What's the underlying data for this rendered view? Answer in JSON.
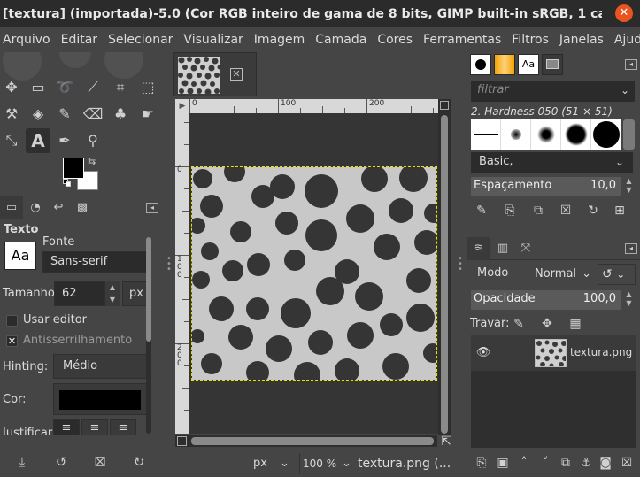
{
  "window": {
    "title": "[textura] (importada)-5.0 (Cor RGB inteiro de gama de 8 bits, GIMP built-in sRGB, 1 ca..."
  },
  "menu": [
    "Arquivo",
    "Editar",
    "Selecionar",
    "Visualizar",
    "Imagem",
    "Camada",
    "Cores",
    "Ferramentas",
    "Filtros",
    "Janelas",
    "Ajuda"
  ],
  "colors": {
    "foreground": "#000000",
    "background": "#ffffff",
    "selection": "#e8e000"
  },
  "tool_options": {
    "section_title": "Texto",
    "font_label": "Fonte",
    "font_button": "Aa",
    "font_value": "Sans-serif",
    "size_label": "Tamanho:",
    "size_value": "62",
    "size_unit": "px",
    "use_editor_label": "Usar editor",
    "antialias_label": "Antisserrilhamento",
    "hinting_label": "Hinting:",
    "hinting_value": "Médio",
    "color_label": "Cor:",
    "justify_label": "Justificar:"
  },
  "rulers": {
    "horizontal": [
      "0",
      "100",
      "200"
    ],
    "vertical": [
      "0",
      "1\n0\n0",
      "2\n0\n0"
    ]
  },
  "status": {
    "unit": "px",
    "zoom": "100 %",
    "filename": "textura.png (..."
  },
  "brushes": {
    "filter_placeholder": "filtrar",
    "selected_brush": "2. Hardness 050 (51 × 51)",
    "preset": "Basic,",
    "spacing_label": "Espaçamento",
    "spacing_value": "10,0"
  },
  "layers": {
    "mode_label": "Modo",
    "mode_value": "Normal",
    "opacity_label": "Opacidade",
    "opacity_value": "100,0",
    "lock_label": "Travar:",
    "items": [
      {
        "name": "textura.png"
      }
    ]
  }
}
